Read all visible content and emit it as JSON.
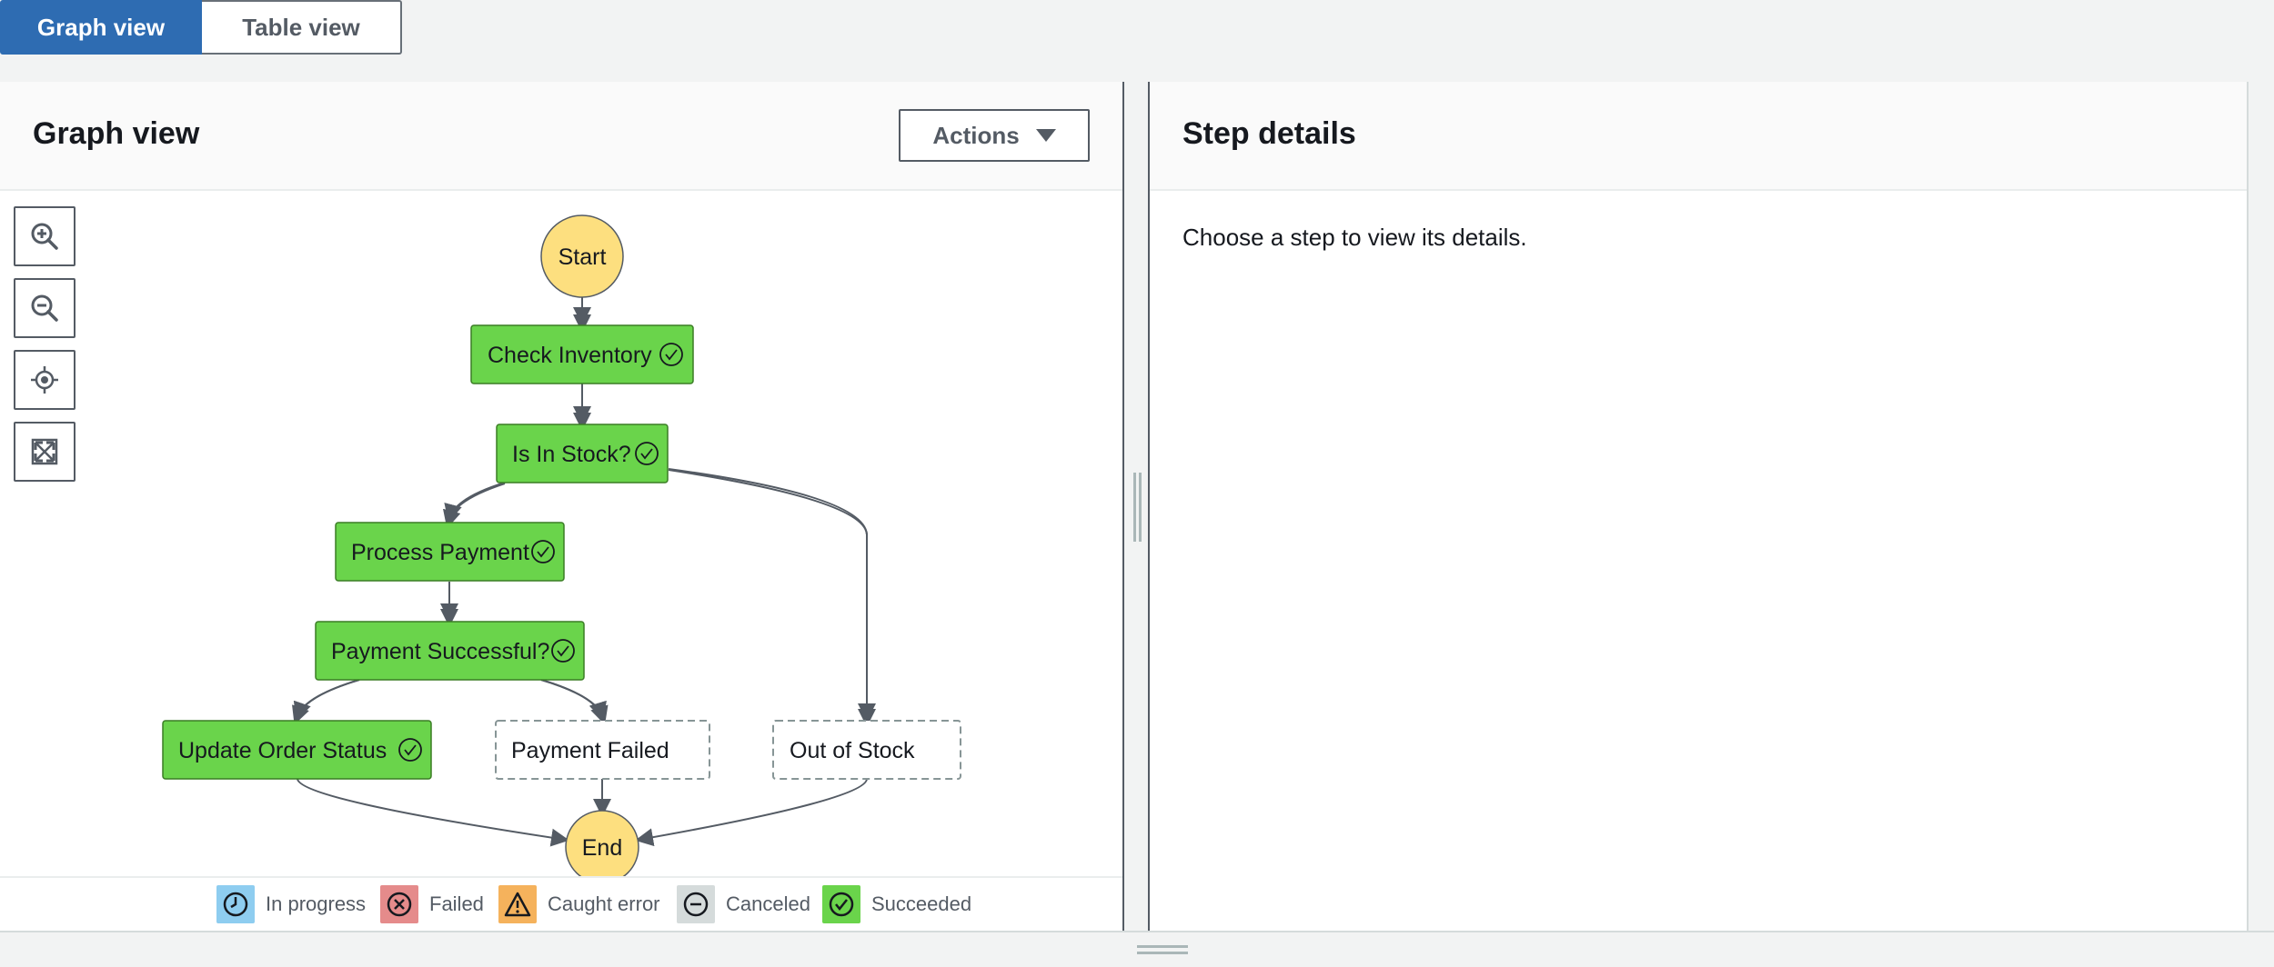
{
  "view_tabs": [
    {
      "label": "Graph view",
      "active": true
    },
    {
      "label": "Table view",
      "active": false
    }
  ],
  "graph_panel": {
    "title": "Graph view",
    "actions_label": "Actions",
    "zoom_controls": [
      "zoom-in-icon",
      "zoom-out-icon",
      "center-icon",
      "fit-to-screen-icon"
    ]
  },
  "graph": {
    "start_label": "Start",
    "end_label": "End",
    "nodes": [
      {
        "id": "check_inventory",
        "label": "Check Inventory",
        "status": "succeeded"
      },
      {
        "id": "is_in_stock",
        "label": "Is In Stock?",
        "status": "succeeded"
      },
      {
        "id": "process_payment",
        "label": "Process Payment",
        "status": "succeeded"
      },
      {
        "id": "payment_successful",
        "label": "Payment Successful?",
        "status": "succeeded"
      },
      {
        "id": "update_order_status",
        "label": "Update Order Status",
        "status": "succeeded"
      },
      {
        "id": "payment_failed",
        "label": "Payment Failed",
        "status": "not-run"
      },
      {
        "id": "out_of_stock",
        "label": "Out of Stock",
        "status": "not-run"
      }
    ]
  },
  "legend": [
    {
      "label": "In progress",
      "icon": "clock-icon",
      "color": "#8ecdf0"
    },
    {
      "label": "Failed",
      "icon": "x-circle-icon",
      "color": "#e58b8b"
    },
    {
      "label": "Caught error",
      "icon": "warning-icon",
      "color": "#f5b25c"
    },
    {
      "label": "Canceled",
      "icon": "minus-circle-icon",
      "color": "#d5dbdb"
    },
    {
      "label": "Succeeded",
      "icon": "check-circle-icon",
      "color": "#6ad44b"
    }
  ],
  "details_panel": {
    "title": "Step details",
    "empty_message": "Choose a step to view its details."
  },
  "colors": {
    "succeeded": "#6ad44b",
    "start_end": "#fddf7f",
    "primary": "#2e6cb2"
  }
}
